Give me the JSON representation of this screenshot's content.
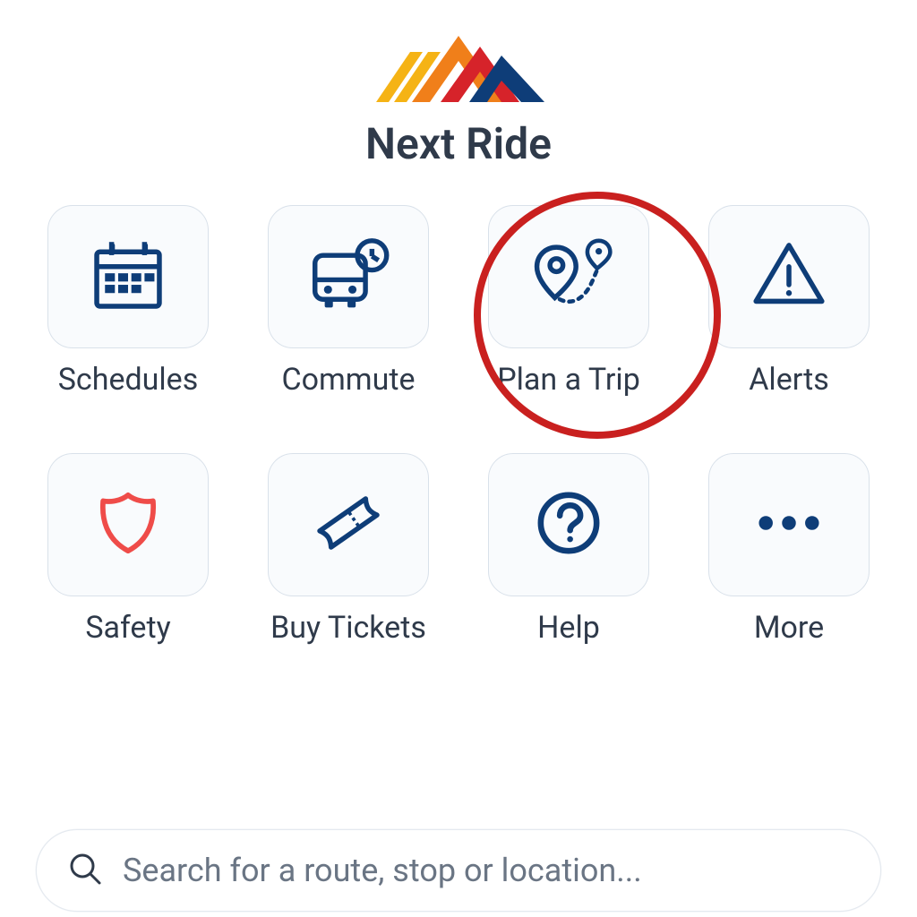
{
  "app_title": "Next Ride",
  "colors": {
    "primary": "#0e3d78",
    "accent_yellow": "#f5b315",
    "accent_orange": "#f07f1a",
    "accent_red": "#d6232a",
    "accent_navy": "#0e3d78",
    "highlight": "#c9201f",
    "safety_red": "#ef4c49"
  },
  "menu": [
    {
      "label": "Schedules",
      "icon": "calendar-icon"
    },
    {
      "label": "Commute",
      "icon": "bus-clock-icon"
    },
    {
      "label": "Plan a Trip",
      "icon": "pin-route-icon",
      "highlighted": true
    },
    {
      "label": "Alerts",
      "icon": "warning-icon"
    },
    {
      "label": "Safety",
      "icon": "shield-icon"
    },
    {
      "label": "Buy Tickets",
      "icon": "ticket-icon"
    },
    {
      "label": "Help",
      "icon": "question-icon"
    },
    {
      "label": "More",
      "icon": "more-dots-icon"
    }
  ],
  "search": {
    "placeholder": "Search for a route, stop or location..."
  }
}
